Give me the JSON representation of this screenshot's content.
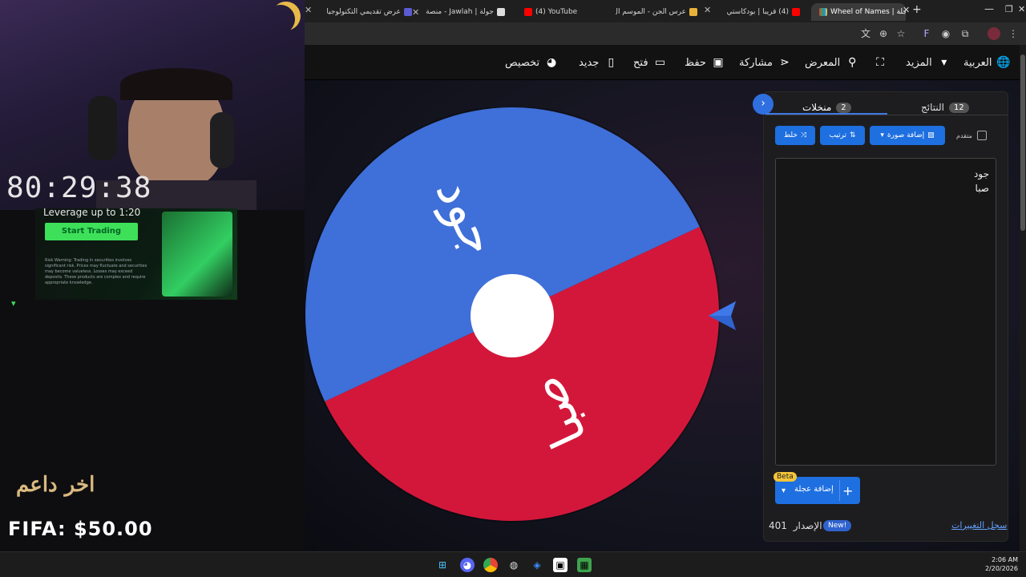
{
  "tabs": [
    {
      "title": "عرض تقديمي التكنولوجيا",
      "color": "#5b5bd6"
    },
    {
      "title": "جولة | Jawlah - منصة",
      "color": "#eeeeee"
    },
    {
      "title": "(4) YouTube",
      "color": "#ff0000"
    },
    {
      "title": "عرس الجن - الموسم ال",
      "color": "#e8b23a"
    },
    {
      "title": "(4) قريبا | بودكاستي",
      "color": "#ff0000"
    },
    {
      "title": "Wheel of Names | عجلة",
      "color": "#4caf50"
    }
  ],
  "toolbar": {
    "language": "العربية",
    "more": "المزيد",
    "gallery": "المعرض",
    "share": "مشاركة",
    "save": "حفظ",
    "open": "فتح",
    "new": "جديد",
    "customize": "تخصيص"
  },
  "wheel": {
    "entries": [
      "جود",
      "صبا"
    ],
    "colors": [
      "#3f6fd8",
      "#d3173a"
    ]
  },
  "panel": {
    "results_tab": "النتائج",
    "results_count": "12",
    "entries_tab": "منخلات",
    "entries_count": "2",
    "advanced_label": "متقدم",
    "add_image": "إضافة صورة",
    "sort": "ترتيب",
    "shuffle": "خلط",
    "entries_text": "جود\nصبا",
    "add_wheel": "إضافة عجلة",
    "beta": "Beta",
    "version_label": "الإصدار",
    "version_number": "401",
    "new_badge": "New!",
    "changelog": "سجل التغييرات"
  },
  "overlay": {
    "timer": "80:29:38",
    "ad_headline": "Leverage up to 1:20",
    "ad_button": "Start Trading",
    "ad_disclaimer": "Risk Warning: Trading in securities involves significant risk. Prices may fluctuate and securities may become valueless. Losses may exceed deposits. These products are complex and require appropriate knowledge.",
    "last_supporter": "اخر داعم",
    "fifa": "FIFA: $50.00"
  },
  "clock": {
    "time": "2:06 AM",
    "date": "2/20/2026"
  }
}
